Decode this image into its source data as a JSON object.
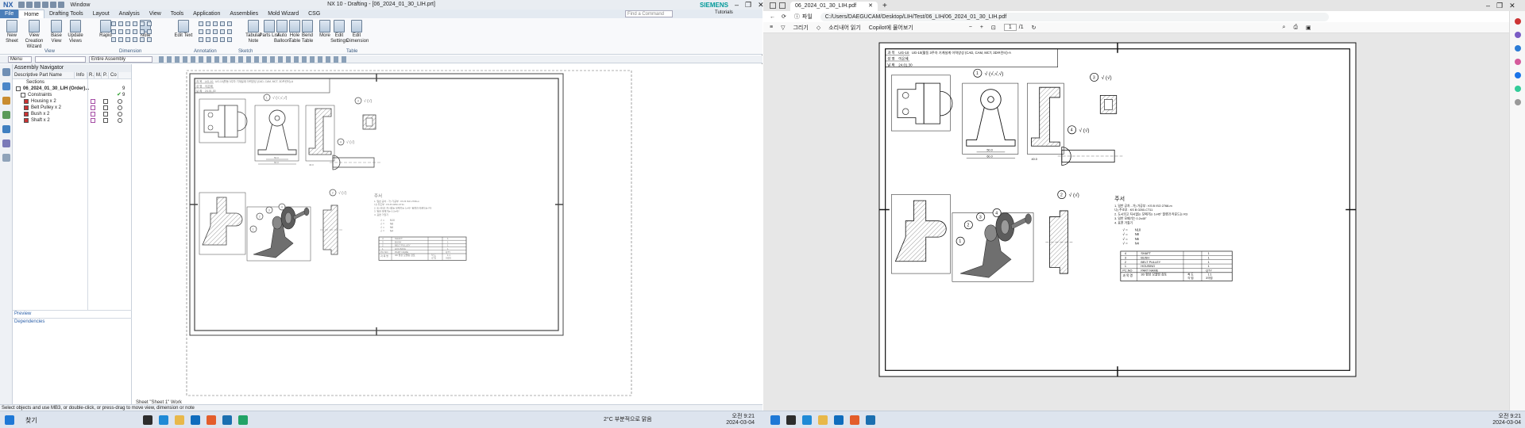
{
  "nx": {
    "logo": "NX",
    "window_menu": "Window",
    "title": "NX 10 - Drafting - [06_2024_01_30_LIH.prt]",
    "brand": "SIEMENS",
    "tabs": [
      "File",
      "Home",
      "Drafting Tools",
      "Layout",
      "Analysis",
      "View",
      "Tools",
      "Application",
      "Assemblies",
      "Mold Wizard",
      "CSG"
    ],
    "active_tab": "Home",
    "find_placeholder": "Find a Command",
    "tutorials": "Tutorials",
    "ribbon_buttons": [
      {
        "label": "New Sheet"
      },
      {
        "label": "View Creation Wizard"
      },
      {
        "label": "Base View"
      },
      {
        "label": "Update Views"
      },
      {
        "label": "Rapid"
      },
      {
        "label": "Note"
      },
      {
        "label": "Edit Text"
      },
      {
        "label": "Tabular Note"
      },
      {
        "label": "Parts List"
      },
      {
        "label": "Auto Balloon"
      },
      {
        "label": "Hole Table"
      },
      {
        "label": "Bend Table"
      },
      {
        "label": "More"
      },
      {
        "label": "Edit Settings"
      },
      {
        "label": "Edit Dimension"
      }
    ],
    "ribbon_groups": [
      "View",
      "Dimension",
      "Annotation",
      "Sketch",
      "Table"
    ],
    "filter_menu": "Menu",
    "filter_scope": "Entire Assembly",
    "navigator": {
      "title": "Assembly Navigator",
      "columns": [
        "Descriptive Part Name",
        "Info",
        "R.",
        "M.",
        "P.",
        "Co"
      ],
      "rows": [
        {
          "name": "Sections",
          "count": ""
        },
        {
          "name": "06_2024_01_30_LIH (Order)...",
          "count": "9"
        },
        {
          "name": "Constraints",
          "count": "9"
        },
        {
          "name": "Housing x 2",
          "count": ""
        },
        {
          "name": "Belt Pulley x 2",
          "count": ""
        },
        {
          "name": "Bush x 2",
          "count": ""
        },
        {
          "name": "Shaft x 2",
          "count": ""
        }
      ],
      "preview": "Preview",
      "dependencies": "Dependencies"
    },
    "sheet_label": "Sheet \"Sheet 1\" Work",
    "status": "Select objects and use MB3, or double-click, or press-drag to move view, dimension or note"
  },
  "edge": {
    "tab_title": "06_2024_01_30_LIH.pdf",
    "address_prefix": "파일",
    "url": "C:/Users/DAEGUCAM/Desktop/LIH/Test/06_LIH/06_2024_01_30_LIH.pdf",
    "toolbar": [
      "그리기",
      "소리내어 읽기",
      "Copilot에 물어보기"
    ],
    "page_current": "1",
    "page_total": "/1"
  },
  "drawing": {
    "header_code": "UG-10(활동 3주차 기계설계 이력양성 (CAD, CAM, MCT, 3D프린터)-A",
    "header_rows": [
      [
        "과 목",
        "UG-10"
      ],
      [
        "성 명",
        "이은혜"
      ],
      [
        "날 짜",
        "24.01.30"
      ]
    ],
    "balloons": [
      "1",
      "2",
      "3",
      "4"
    ],
    "notes_title": "주서",
    "notes": [
      "1. 일반 공차 - 가) 가공부 : KS B ISO 2768-m",
      "   나) 주조부 : KS B 0250-CT11",
      "2. 도시되고 지시없는 모떼기는 1x45° 필렛과 라운드는 R3",
      "3. 일반 모떼기는 0.2x45°",
      "4. 표면 거칠기"
    ],
    "roughness": [
      "N10",
      "N8",
      "N6",
      "N4"
    ],
    "parts_list": [
      {
        "no": "4",
        "name": "SHAFT",
        "qty": "1"
      },
      {
        "no": "3",
        "name": "BUSH",
        "qty": "1"
      },
      {
        "no": "2",
        "name": "BELT PULLEY",
        "qty": "1"
      },
      {
        "no": "1",
        "name": "HOUSING",
        "qty": "1"
      }
    ],
    "parts_header": {
      "no": "PC.NO",
      "name": "PART NAME",
      "qty": "QTY"
    },
    "footer": {
      "course": "과 목 명",
      "subject": "3D 형상 모델링 검토",
      "scale_label": "척 도",
      "scale": "1:1",
      "proj_label": "각 법",
      "proj": "3각법"
    },
    "dims": [
      "16.0",
      "60.0",
      "50.0",
      "40.0",
      "20.0",
      "8.0",
      "36.0",
      "Ø15.0",
      "Ø60.0"
    ]
  },
  "taskbar": {
    "search": "찾기",
    "weather": "2°C 부분적으로 맑음",
    "time": "오전 9:21",
    "date": "2024-03-04"
  }
}
